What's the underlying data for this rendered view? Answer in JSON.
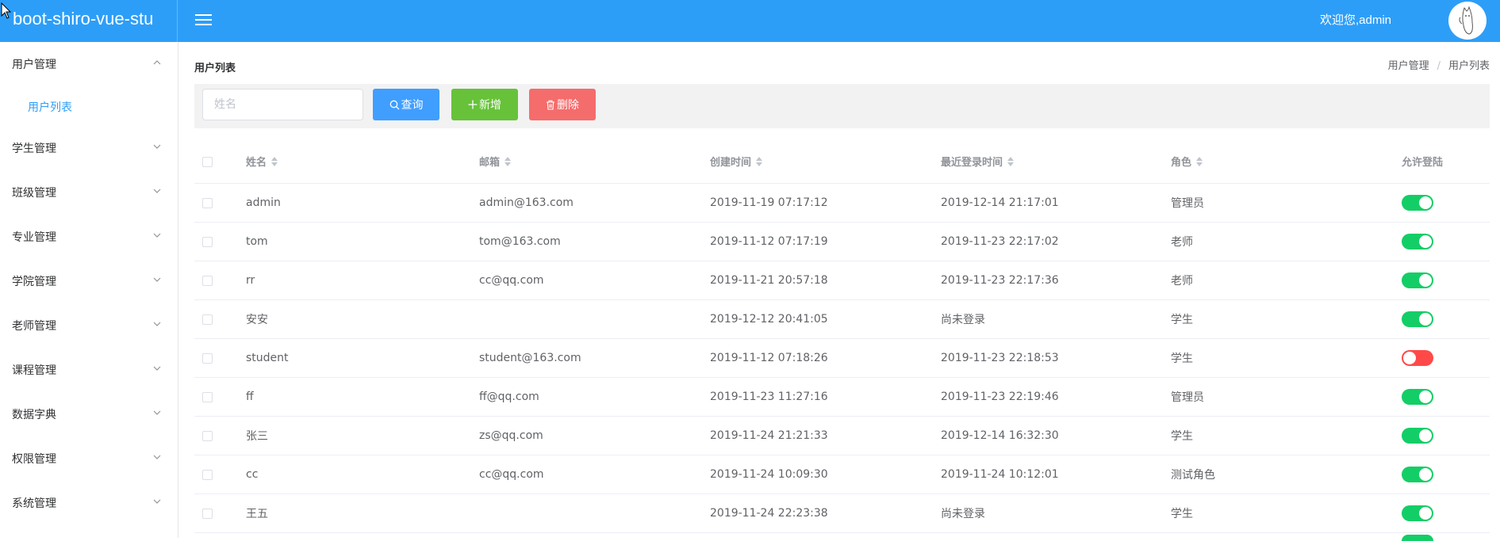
{
  "app": {
    "title": "boot-shiro-vue-stu",
    "welcome": "欢迎您,admin"
  },
  "colors": {
    "primary": "#2d9ef8",
    "query": "#409eff",
    "add": "#67c23a",
    "delete": "#f56c6c",
    "switch_on": "#13ce66",
    "switch_off": "#ff4949"
  },
  "sidebar": {
    "items": [
      {
        "label": "用户管理",
        "icon": "chevron-up-icon",
        "expanded": true,
        "children": [
          {
            "label": "用户列表",
            "active": true
          }
        ]
      },
      {
        "label": "学生管理",
        "icon": "chevron-down-icon"
      },
      {
        "label": "班级管理",
        "icon": "chevron-down-icon"
      },
      {
        "label": "专业管理",
        "icon": "chevron-down-icon"
      },
      {
        "label": "学院管理",
        "icon": "chevron-down-icon"
      },
      {
        "label": "老师管理",
        "icon": "chevron-down-icon"
      },
      {
        "label": "课程管理",
        "icon": "chevron-down-icon"
      },
      {
        "label": "数据字典",
        "icon": "chevron-down-icon"
      },
      {
        "label": "权限管理",
        "icon": "chevron-down-icon"
      },
      {
        "label": "系统管理",
        "icon": "chevron-down-icon"
      }
    ]
  },
  "page": {
    "title": "用户列表",
    "breadcrumb": [
      "用户管理",
      "用户列表"
    ]
  },
  "toolbar": {
    "search_placeholder": "姓名",
    "search_value": "",
    "query_label": "查询",
    "add_label": "新增",
    "delete_label": "删除"
  },
  "table": {
    "columns": [
      "姓名",
      "邮箱",
      "创建时间",
      "最近登录时间",
      "角色",
      "允许登陆"
    ],
    "rows": [
      {
        "name": "admin",
        "email": "admin@163.com",
        "created": "2019-11-19 07:17:12",
        "last_login": "2019-12-14 21:17:01",
        "role": "管理员",
        "allow": true
      },
      {
        "name": "tom",
        "email": "tom@163.com",
        "created": "2019-11-12 07:17:19",
        "last_login": "2019-11-23 22:17:02",
        "role": "老师",
        "allow": true
      },
      {
        "name": "rr",
        "email": "cc@qq.com",
        "created": "2019-11-21 20:57:18",
        "last_login": "2019-11-23 22:17:36",
        "role": "老师",
        "allow": true
      },
      {
        "name": "安安",
        "email": "",
        "created": "2019-12-12 20:41:05",
        "last_login": "尚未登录",
        "role": "学生",
        "allow": true
      },
      {
        "name": "student",
        "email": "student@163.com",
        "created": "2019-11-12 07:18:26",
        "last_login": "2019-11-23 22:18:53",
        "role": "学生",
        "allow": false
      },
      {
        "name": "ff",
        "email": "ff@qq.com",
        "created": "2019-11-23 11:27:16",
        "last_login": "2019-11-23 22:19:46",
        "role": "管理员",
        "allow": true
      },
      {
        "name": "张三",
        "email": "zs@qq.com",
        "created": "2019-11-24 21:21:33",
        "last_login": "2019-12-14 16:32:30",
        "role": "学生",
        "allow": true
      },
      {
        "name": "cc",
        "email": "cc@qq.com",
        "created": "2019-11-24 10:09:30",
        "last_login": "2019-11-24 10:12:01",
        "role": "测试角色",
        "allow": true
      },
      {
        "name": "王五",
        "email": "",
        "created": "2019-11-24 22:23:38",
        "last_login": "尚未登录",
        "role": "学生",
        "allow": true
      }
    ]
  }
}
